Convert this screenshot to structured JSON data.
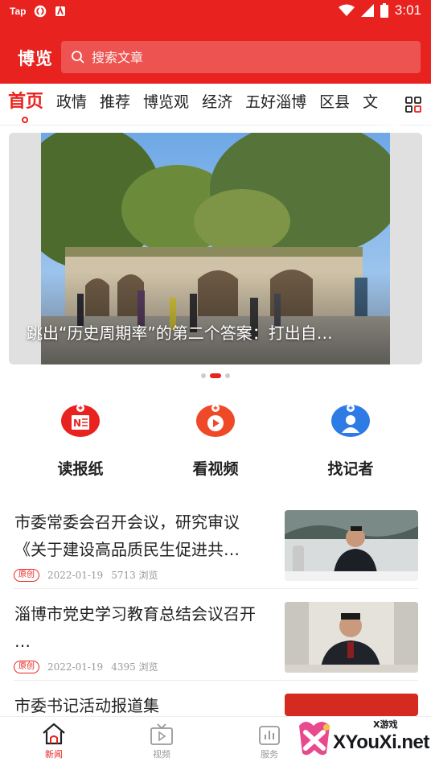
{
  "status_bar": {
    "left_label": "Tap",
    "time": "3:01",
    "icons": [
      "app-logo-icon",
      "news-app-icon",
      "wifi-icon",
      "signal-icon",
      "battery-icon"
    ]
  },
  "header": {
    "brand": "博览",
    "search_placeholder": "搜索文章",
    "bg_color": "#e8231f"
  },
  "tabs": {
    "items": [
      "首页",
      "政情",
      "推荐",
      "博览观",
      "经济",
      "五好淄博",
      "区县",
      "文"
    ],
    "active_index": 0,
    "more_icon": "grid-icon"
  },
  "banner": {
    "caption": "跳出“历史周期率”的第二个答案：打出自…",
    "page_count": 3,
    "active_page": 1
  },
  "quick_actions": [
    {
      "label": "读报纸",
      "icon": "newspaper-icon",
      "color": "#e8231f"
    },
    {
      "label": "看视频",
      "icon": "play-icon",
      "color": "#ef4a27"
    },
    {
      "label": "找记者",
      "icon": "reporter-icon",
      "color": "#2f7be6"
    }
  ],
  "news": [
    {
      "title": "市委常委会召开会议，研究审议《关于建设高品质民生促进共…",
      "badge": "原创",
      "date": "2022-01-19",
      "views": "5713 浏览"
    },
    {
      "title": "淄博市党史学习教育总结会议召开 …",
      "badge": "原创",
      "date": "2022-01-19",
      "views": "4395 浏览"
    },
    {
      "title": "市委书记活动报道集",
      "badge": "",
      "date": "",
      "views": ""
    }
  ],
  "bottom_nav": [
    {
      "label": "新闻",
      "icon": "home-icon",
      "active": true
    },
    {
      "label": "视频",
      "icon": "tv-icon",
      "active": false
    },
    {
      "label": "服务",
      "icon": "service-icon",
      "active": false
    }
  ],
  "watermark": {
    "brand": "XYouXi.net",
    "small_text": "X游戏"
  }
}
